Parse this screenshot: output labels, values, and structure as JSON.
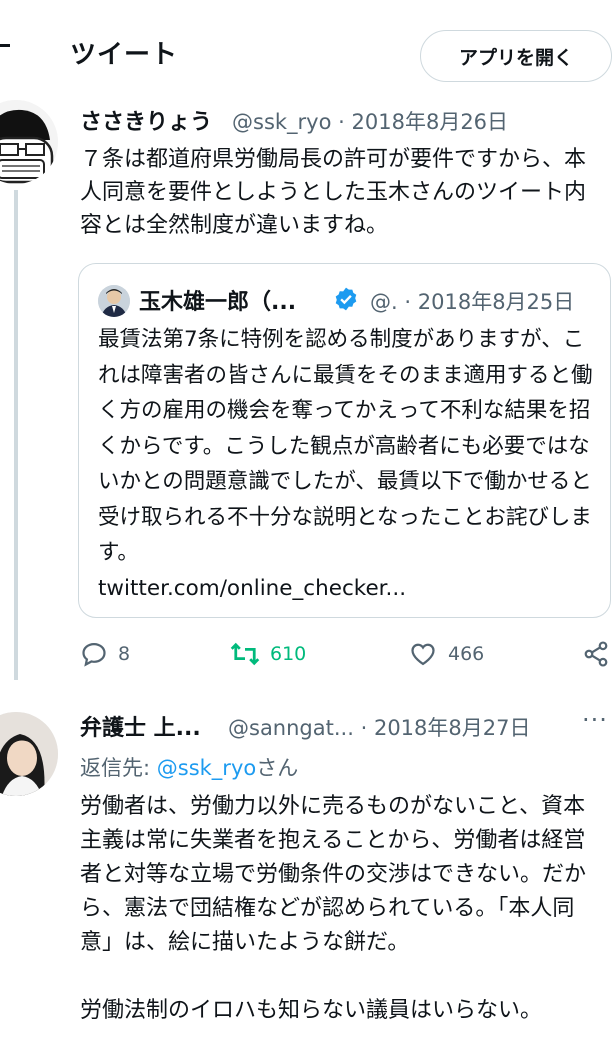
{
  "header": {
    "title": "ツイート",
    "open_app_label": "アプリを開く"
  },
  "tweet1": {
    "display_name": "ささきりょう",
    "handle": "@ssk_ryo",
    "separator": "·",
    "date": "2018年8月26日",
    "text": "７条は都道府県労働局長の許可が要件ですから、本人同意を要件としようとした玉木さんのツイート内容とは全然制度が違いますね。"
  },
  "quote": {
    "display_name": "玉木雄一郎（...",
    "handle": "@.",
    "separator": "·",
    "date": "2018年8月25日",
    "text": "最賃法第7条に特例を認める制度がありますが、これは障害者の皆さんに最賃をそのまま適用すると働く方の雇用の機会を奪ってかえって不利な結果を招くからです。こうした観点が高齢者にも必要ではないかとの問題意識でしたが、最賃以下で働かせると受け取られる不十分な説明となったことお詫びします。",
    "link": "twitter.com/online_checker..."
  },
  "actions": {
    "replies": "8",
    "retweets": "610",
    "likes": "466"
  },
  "tweet2": {
    "display_name": "弁護士 上...",
    "handle": "@sanngat...",
    "separator": "·",
    "date": "2018年8月27日",
    "more": "···",
    "reply_prefix": "返信先: ",
    "reply_handle": "@ssk_ryo",
    "reply_suffix": "さん",
    "paragraph1": "労働者は、労働力以外に売るものがないこと、資本主義は常に失業者を抱えることから、労働者は経営者と対等な立場で労働条件の交渉はできない。だから、憲法で団結権などが認められている。「本人同意」は、絵に描いたような餅だ。",
    "paragraph2": "労働法制のイロハも知らない議員はいらない。"
  },
  "colors": {
    "text": "#0f1419",
    "secondary": "#536471",
    "link": "#1d9bf0",
    "retweet": "#00ba7c",
    "border": "#cfd9de",
    "verified": "#1d9bf0"
  }
}
